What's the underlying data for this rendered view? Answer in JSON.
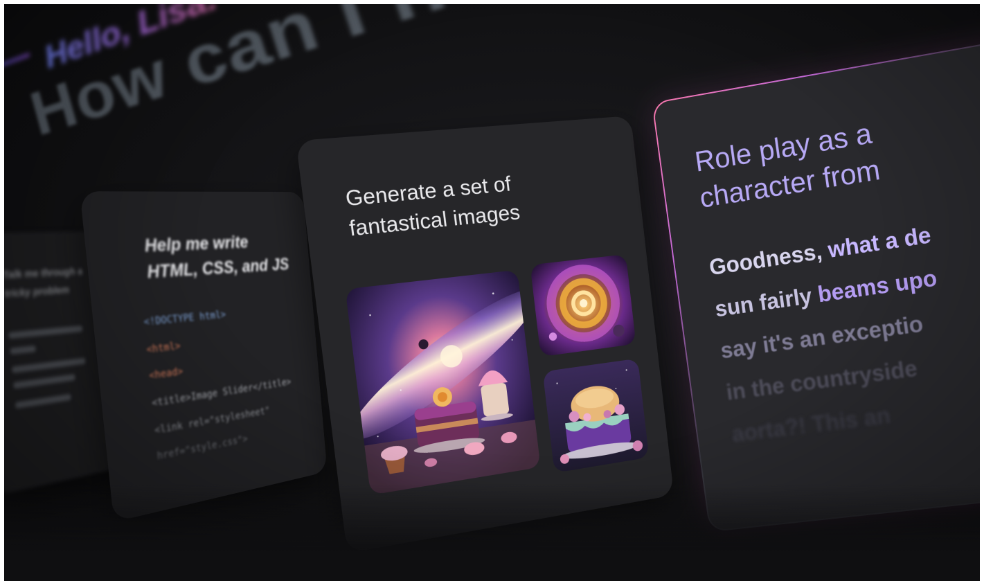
{
  "greeting": {
    "hello": "Hello, Lisa.",
    "question": "How can I help you today?"
  },
  "cards": {
    "puzzle": {
      "title": "Talk me through a tricky problem"
    },
    "code": {
      "title": "Help me write HTML, CSS, and JS",
      "lines": [
        "<!DOCTYPE html>",
        "<html>",
        "<head>",
        "<title>Image Slider</title>",
        "<link rel=\"stylesheet\"",
        "href=\"style.css\">"
      ]
    },
    "images": {
      "title": "Generate a set of fantastical images",
      "images": [
        {
          "alt": "galaxy-cake-scene"
        },
        {
          "alt": "cosmic-swirl"
        },
        {
          "alt": "purple-frosted-cake"
        }
      ]
    },
    "roleplay": {
      "title": "Role play as a\ncharacter from",
      "reply_lines": [
        {
          "plain": "Goodness, ",
          "bold": "what a de"
        },
        {
          "plain": "sun fairly ",
          "bold": "beams upo"
        },
        {
          "plain": "say it's an exceptio",
          "bold": ""
        },
        {
          "plain": "in the countryside",
          "bold": ""
        },
        {
          "plain": "aorta?! This an",
          "bold": ""
        }
      ]
    }
  },
  "colors": {
    "background": "#121214",
    "card": "#262629",
    "accent_gradient_start": "#6f7ff0",
    "accent_gradient_end": "#d96aa8",
    "roleplay_title": "#b7a9f5",
    "highlight_border": "#ff7ab0"
  }
}
